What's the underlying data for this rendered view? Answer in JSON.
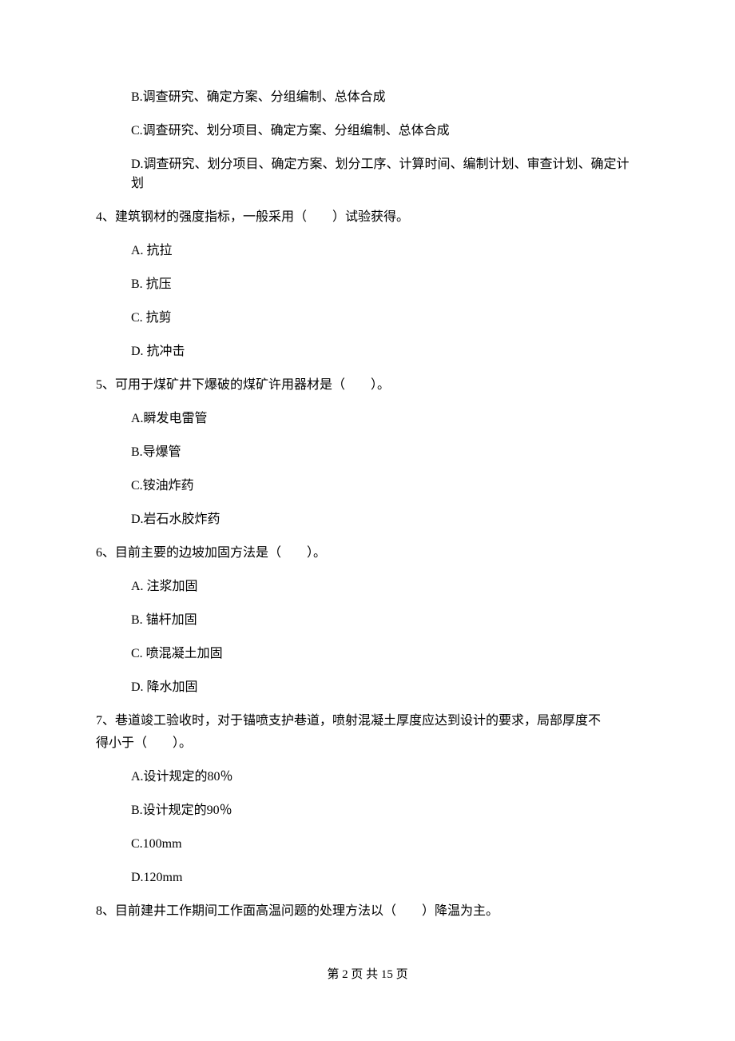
{
  "prev_question_options": {
    "b": "B.调查研究、确定方案、分组编制、总体合成",
    "c": "C.调查研究、划分项目、确定方案、分组编制、总体合成",
    "d": "D.调查研究、划分项目、确定方案、划分工序、计算时间、编制计划、审查计划、确定计划"
  },
  "questions": [
    {
      "prompt": "4、建筑钢材的强度指标，一般采用（　　）试验获得。",
      "options": {
        "a": "A.  抗拉",
        "b": "B.  抗压",
        "c": "C.  抗剪",
        "d": "D.  抗冲击"
      }
    },
    {
      "prompt": "5、可用于煤矿井下爆破的煤矿许用器材是（　　）。",
      "options": {
        "a": "A.瞬发电雷管",
        "b": "B.导爆管",
        "c": "C.铵油炸药",
        "d": "D.岩石水胶炸药"
      }
    },
    {
      "prompt": "6、目前主要的边坡加固方法是（　　）。",
      "options": {
        "a": "A.  注浆加固",
        "b": "B.  锚杆加固",
        "c": "C.  喷混凝土加固",
        "d": "D.  降水加固"
      }
    },
    {
      "prompt_line1": "7、巷道竣工验收时，对于锚喷支护巷道，喷射混凝土厚度应达到设计的要求，局部厚度不",
      "prompt_line2": "得小于（　　）。",
      "options": {
        "a": "A.设计规定的80％",
        "b": "B.设计规定的90％",
        "c": "C.100mm",
        "d": "D.120mm"
      }
    },
    {
      "prompt": "8、目前建井工作期间工作面高温问题的处理方法以（　　）降温为主。"
    }
  ],
  "footer": "第 2 页 共 15 页"
}
